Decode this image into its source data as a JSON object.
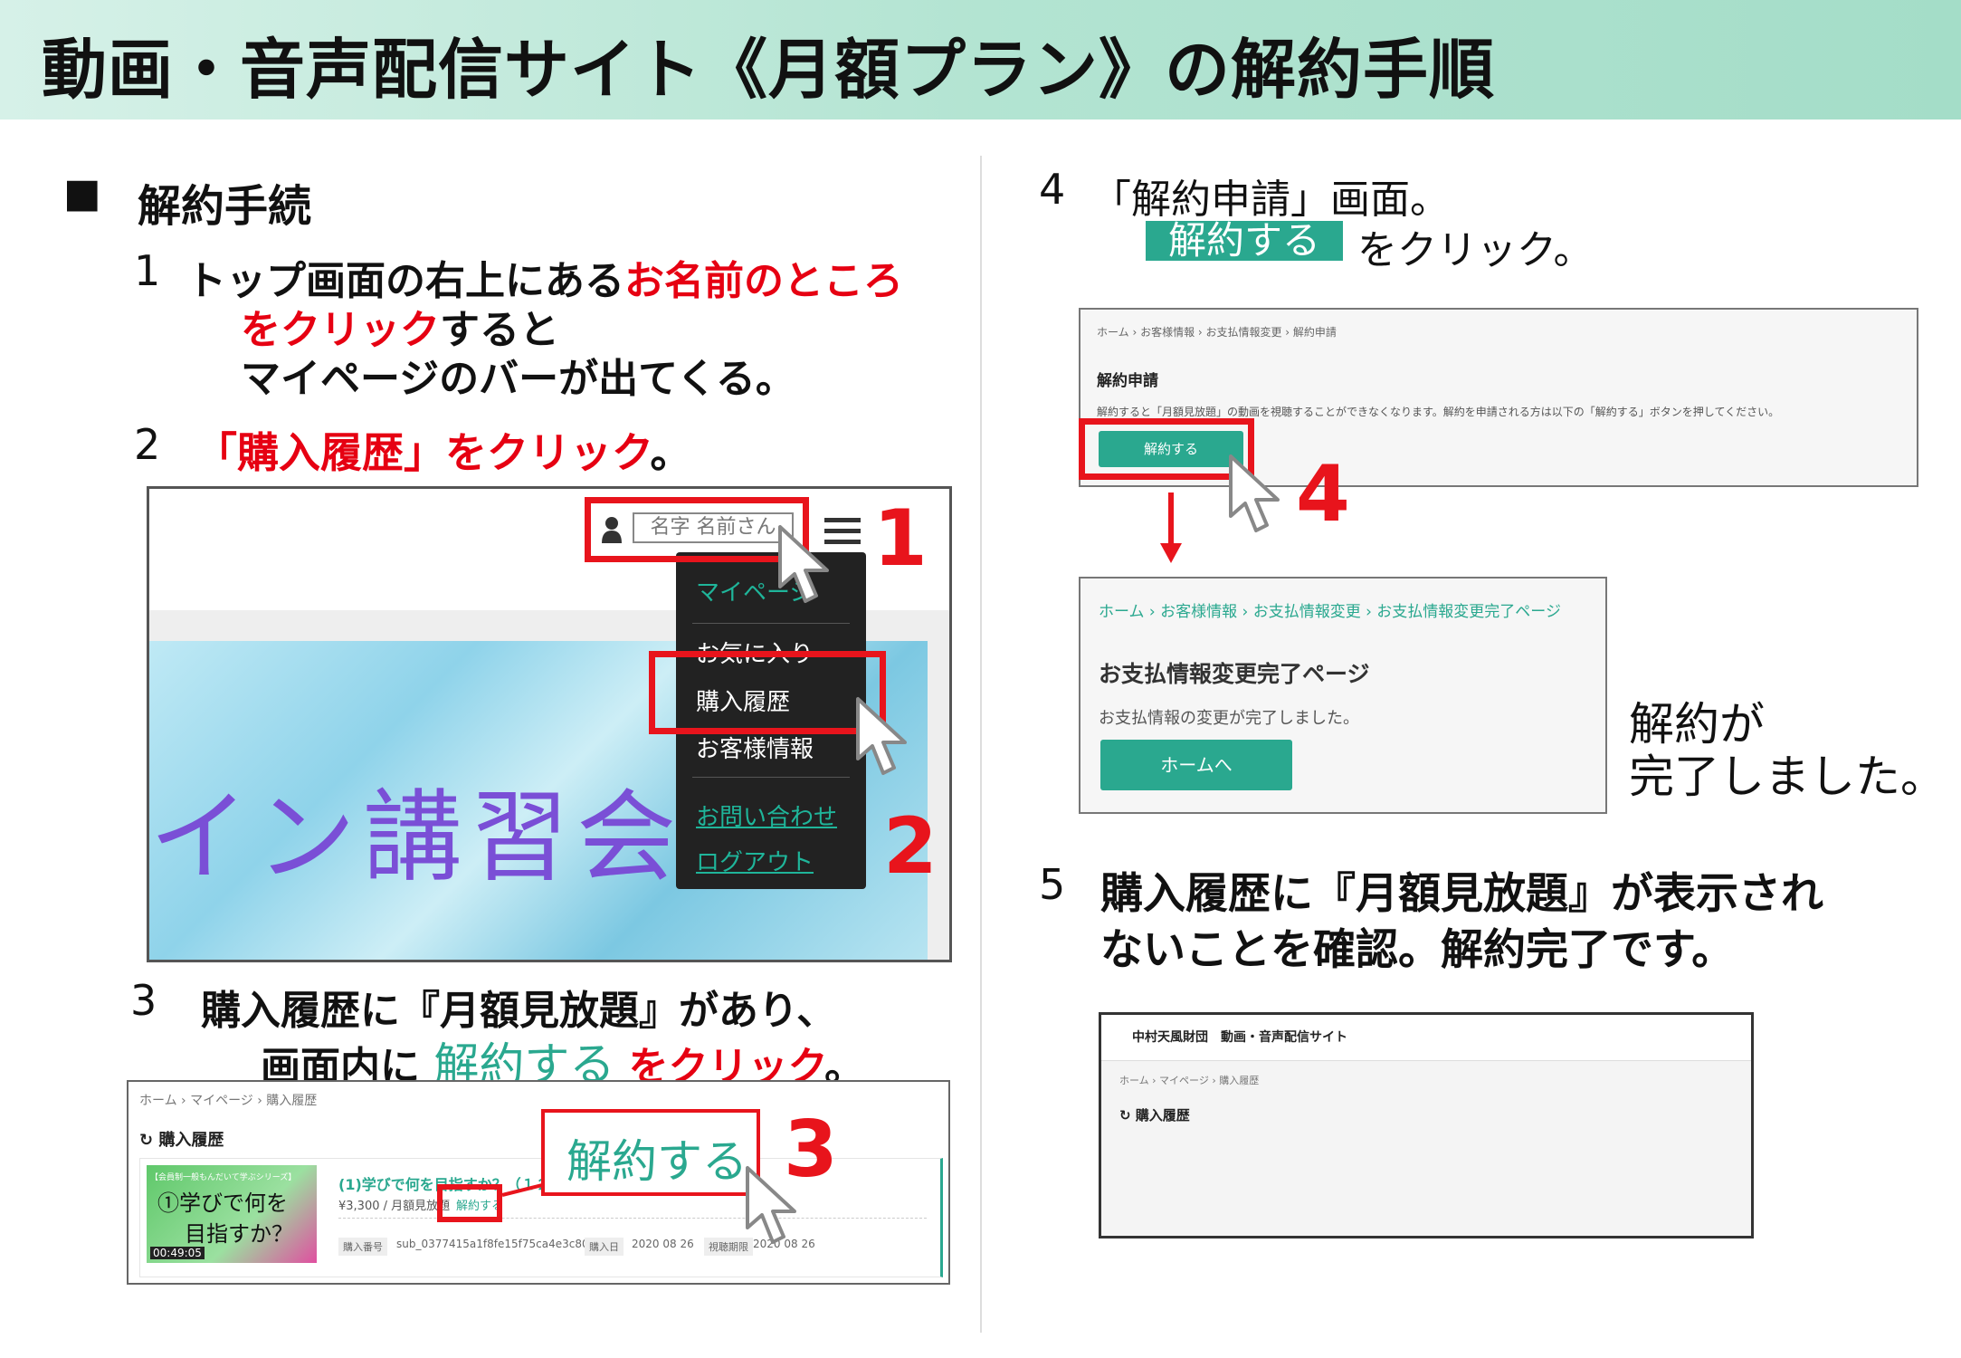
{
  "header": {
    "title": "動画・音声配信サイト《月額プラン》の解約手順"
  },
  "section": {
    "marker": "■",
    "title": "解約手続"
  },
  "step1": {
    "num": "1",
    "text_a": "トップ画面の右上にある",
    "text_b": "お名前のところ",
    "text_c": "をクリック",
    "text_d": "すると",
    "text_e": "マイページのバーが出てくる。"
  },
  "step2": {
    "num": "2",
    "text_a": "「購入履歴」をクリック",
    "text_b": "。"
  },
  "shot1": {
    "user_name": "名字 名前さん",
    "menu": [
      "マイページ",
      "お気に入り",
      "購入履歴",
      "お客様情報",
      "お問い合わせ",
      "ログアウト"
    ],
    "banner_text": "イン講習会",
    "label1": "1",
    "label2": "2"
  },
  "step3": {
    "num": "3",
    "text_a": "購入履歴に『月額見放題』があり、",
    "text_b": "画面内に",
    "text_c": "解約する",
    "text_d": "をクリック",
    "text_e": "。"
  },
  "shot3": {
    "breadcrumb": "ホーム › マイページ › 購入履歴",
    "heading": "購入履歴",
    "thumb_series": "【会員制一般もんだいて学ぶシリーズ】",
    "thumb_title_a": "①学びで何を",
    "thumb_title_b": "目指すか？",
    "thumb_time": "00:49:05",
    "item_title": "(1)学びで何を目指すか？（１２）",
    "item_price": "¥3,300 / 月額見放題",
    "cancel_link": "解約する",
    "purchase_no_label": "購入番号",
    "purchase_no": "sub_0377415a1f8fe15f75ca4e3c80",
    "purchase_date_label": "購入日",
    "purchase_date": "2020 08 26",
    "period_label": "視聴期限",
    "period": "2020 08 26",
    "callout": "解約する",
    "label3": "3"
  },
  "step4": {
    "num": "4",
    "text_a": "「解約申請」画面。",
    "button": "解約する",
    "text_b": "をクリック。"
  },
  "shot4": {
    "breadcrumb": "ホーム › お客様情報 › お支払情報変更 › 解約申請",
    "heading": "解約申請",
    "desc": "解約すると「月額見放題」の動画を視聴することができなくなります。解約を申請される方は以下の「解約する」ボタンを押してください。",
    "button": "解約する",
    "label4": "4"
  },
  "shot5": {
    "breadcrumb": "ホーム › お客様情報 › お支払情報変更 › お支払情報変更完了ページ",
    "heading": "お支払情報変更完了ページ",
    "desc": "お支払情報の変更が完了しました。",
    "button": "ホームへ"
  },
  "done": {
    "line1": "解約が",
    "line2": "完了しました。"
  },
  "step5": {
    "num": "5",
    "line1": "購入履歴に『月額見放題』が表示され",
    "line2": "ないことを確認。解約完了です。"
  },
  "shot6": {
    "site_title": "中村天風財団　動画・音声配信サイト",
    "breadcrumb": "ホーム › マイページ › 購入履歴",
    "heading": "購入履歴"
  },
  "colors": {
    "accent_red": "#e8141c",
    "accent_green": "#2aa88f",
    "header_bg": "#b3e4d2"
  }
}
